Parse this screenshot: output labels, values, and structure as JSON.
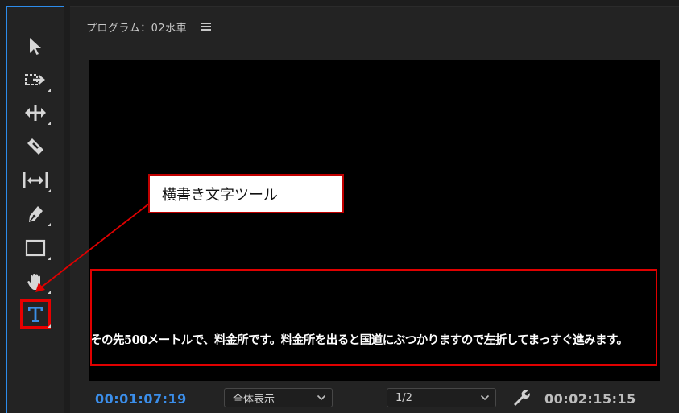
{
  "program_monitor": {
    "title": "プログラム：02水車",
    "caption_text": "その先500メートルで、料金所です。料金所を出ると国道にぶつかりますので左折してまっすぐ進みます。",
    "current_timecode": "00:01:07:19",
    "duration_timecode": "00:02:15:15",
    "zoom_select": {
      "value": "全体表示",
      "icon": "chevron-down-icon"
    },
    "resolution_select": {
      "value": "1/2",
      "icon": "chevron-down-icon"
    },
    "settings_icon": "wrench-icon",
    "menu_icon": "hamburger-menu-icon"
  },
  "tools": [
    {
      "name": "selection-tool",
      "icon": "arrow-cursor-icon"
    },
    {
      "name": "track-select-tool",
      "icon": "track-select-icon"
    },
    {
      "name": "ripple-edit-tool",
      "icon": "ripple-edit-icon"
    },
    {
      "name": "razor-tool",
      "icon": "razor-icon"
    },
    {
      "name": "slip-tool",
      "icon": "slip-icon"
    },
    {
      "name": "pen-tool",
      "icon": "pen-icon"
    },
    {
      "name": "rectangle-tool",
      "icon": "rectangle-icon"
    },
    {
      "name": "hand-tool",
      "icon": "hand-icon"
    },
    {
      "name": "type-tool",
      "icon": "type-t-icon",
      "highlighted": true
    }
  ],
  "annotation": {
    "callout_label": "横書き文字ツール",
    "highlight_color": "#e00000"
  },
  "colors": {
    "accent": "#2d8ceb",
    "timecode_current": "#3b8eea",
    "panel_bg": "#232323"
  }
}
